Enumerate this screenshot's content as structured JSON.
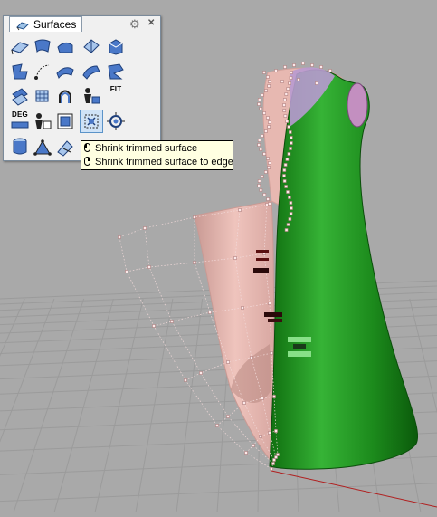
{
  "panel": {
    "tab_label": "Surfaces",
    "tab_icon": "surface-tab-icon",
    "gear_icon": "gear-icon",
    "close_icon": "close-icon",
    "buttons": [
      {
        "icon": "surface-from-corner-points-icon"
      },
      {
        "icon": "surface-from-edge-curves-icon"
      },
      {
        "icon": "surface-from-planar-curves-icon"
      },
      {
        "icon": "rectangular-plane-icon"
      },
      {
        "icon": "extrude-curve-icon"
      },
      {
        "icon": "surface-loft-icon"
      },
      {
        "icon": "rail-revolve-icon"
      },
      {
        "icon": "sweep-one-rail-icon"
      },
      {
        "icon": "sweep-two-rails-icon"
      },
      {
        "icon": "blend-surface-icon"
      },
      {
        "icon": "patch-icon"
      },
      {
        "icon": "network-surface-icon"
      },
      {
        "icon": "revolve-icon"
      },
      {
        "icon": "edit-point-icon"
      },
      {
        "label": "FIT"
      },
      {
        "label": "DEG"
      },
      {
        "icon": "change-degree-icon"
      },
      {
        "icon": "shrink-trimmed-surface-icon"
      },
      {
        "icon": "shrink-trimmed-surface-active-icon"
      },
      {
        "icon": "untrim-icon"
      },
      {
        "icon": "cylinder-surface-icon"
      },
      {
        "icon": "planar-triangle-surface-icon"
      },
      {
        "icon": "plane-through-points-icon"
      }
    ]
  },
  "tooltip": {
    "line1": "Shrink trimmed surface",
    "line2": "Shrink trimmed surface to edge"
  },
  "colors": {
    "viewport_bg": "#a9a9a9",
    "grid": "#9c9c9c",
    "dress_green": "#1a8c1a",
    "dress_pink": "#e8b4ae",
    "control_points": "#f0d0d0",
    "axis_red": "#b02020"
  }
}
